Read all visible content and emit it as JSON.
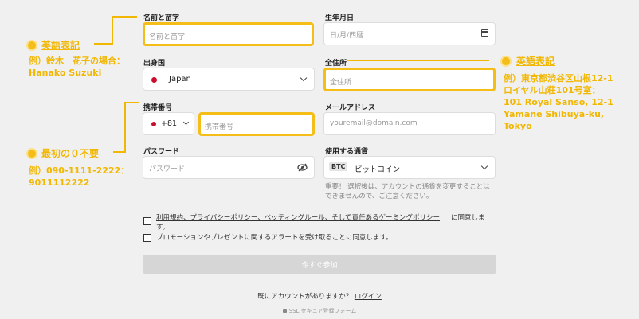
{
  "colors": {
    "accent": "#f2b700",
    "highlight_border": "#f5bd17",
    "button_disabled": "#d6d6d6"
  },
  "form": {
    "name_label": "名前と苗字",
    "name_placeholder": "名前と苗字",
    "birth_label": "生年月日",
    "birth_placeholder": "日/月/西暦",
    "country_label": "出身国",
    "country_value": "Japan",
    "address_label": "全住所",
    "address_placeholder": "全住所",
    "phone_label": "携帯番号",
    "phone_code": "+81",
    "phone_placeholder": "携帯番号",
    "email_label": "メールアドレス",
    "email_placeholder": "youremail@domain.com",
    "password_label": "パスワード",
    "password_placeholder": "パスワード",
    "currency_label": "使用する通貨",
    "currency_badge": "BTC",
    "currency_value": "ビットコイン",
    "currency_note_line1": "重要！ 選択後は、アカウントの通貨を変更することは",
    "currency_note_line2": "できませんので、ご注意ください。",
    "terms_text_1": "利用規約、プライバシーポリシー、ベッティングルール、そして責任あるゲーミングポリシー",
    "terms_text_2": "に同意しま",
    "terms_text_3": "す。",
    "promo_text": "プロモーションやプレゼントに関するアラートを受け取ることに同意します。",
    "submit_label": "今すぐ参加",
    "have_account": "既にアカウントがありますか？",
    "login_link": "ログイン",
    "secure_form": "SSL セキュア登録フォーム"
  },
  "annotations": {
    "left_top_title": "英語表記",
    "left_top_line1": "例）鈴木　花子の場合：",
    "left_top_line2": "Hanako Suzuki",
    "right_title": "英語表記",
    "right_line1": "例）東京都渋谷区山根12-1",
    "right_line2": "ロイヤル山荘101号室：",
    "right_line3": "101 Royal Sanso, 12-1",
    "right_line4": "Yamane Shibuya-ku,",
    "right_line5": "Tokyo",
    "left_bottom_title": "最初の０不要",
    "left_bottom_line1": "例）090-1111-2222：",
    "left_bottom_line2": "9011112222"
  }
}
